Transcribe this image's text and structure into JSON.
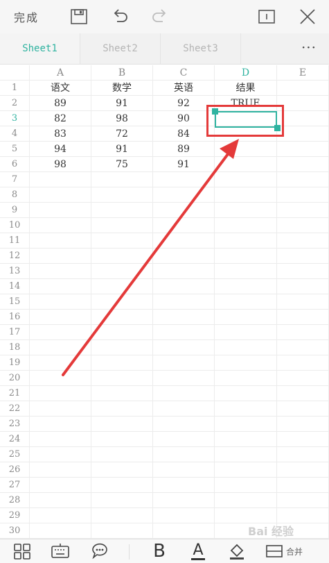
{
  "toolbar": {
    "done_label": "完成",
    "save_icon": "save-icon",
    "undo_icon": "undo-icon",
    "redo_icon": "redo-icon",
    "window_icon": "window-icon",
    "close_icon": "close-icon"
  },
  "tabs": [
    {
      "label": "Sheet1",
      "active": true
    },
    {
      "label": "Sheet2",
      "active": false
    },
    {
      "label": "Sheet3",
      "active": false
    }
  ],
  "more_label": "···",
  "columns": [
    "A",
    "B",
    "C",
    "D",
    "E"
  ],
  "active_column": "D",
  "active_row": 3,
  "rows": [
    [
      "语文",
      "数学",
      "英语",
      "结果",
      ""
    ],
    [
      "89",
      "91",
      "92",
      "TRUE",
      ""
    ],
    [
      "82",
      "98",
      "90",
      "",
      ""
    ],
    [
      "83",
      "72",
      "84",
      "",
      ""
    ],
    [
      "94",
      "91",
      "89",
      "",
      ""
    ],
    [
      "98",
      "75",
      "91",
      "",
      ""
    ]
  ],
  "row_count": 30,
  "bottom_icons": [
    "grid-icon",
    "keyboard-icon",
    "comment-icon",
    "bold-icon",
    "font-color-icon",
    "fill-color-icon",
    "merge-cell-icon"
  ],
  "bold_label": "B",
  "font_color_label": "A",
  "merge_label": "合并",
  "watermark": "Bai 经验",
  "colors": {
    "accent": "#2fb3a0",
    "annotation": "#e43a3a"
  }
}
